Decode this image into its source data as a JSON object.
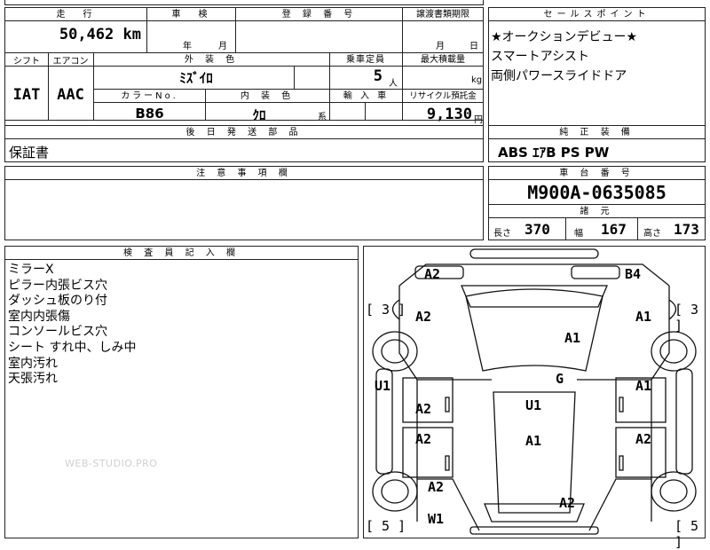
{
  "header_labels": {
    "mileage": "走　行",
    "inspection": "車　検",
    "registration": "登 録 番 号",
    "transfer_deadline": "譲渡書類期限",
    "sales_point": "セールスポイント",
    "shift": "シフト",
    "aircon": "エアコン",
    "exterior_color": "外 装 色",
    "capacity": "乗車定員",
    "max_load": "最大積載量",
    "color_no": "カラーNo.",
    "interior_color": "内 装 色",
    "import": "輸 入 車",
    "recycle": "リサイクル預託金",
    "later_parts": "後 日 発 送 部 品",
    "standard_equipment": "純 正 装 備",
    "notes": "注 意 事 項 欄",
    "chassis_number": "車 台 番 号",
    "specs": "諸 元",
    "inspector_notes": "検 査 員 記 入 欄"
  },
  "values": {
    "mileage": "50,462",
    "mileage_unit": "km",
    "inspection_year_unit": "年",
    "inspection_month_unit": "月",
    "transfer_month_unit": "月",
    "transfer_day_unit": "日",
    "shift": "IAT",
    "aircon": "AAC",
    "exterior_color": "ﾐｽﾞｲﾛ",
    "capacity": "5",
    "capacity_unit": "人",
    "max_load_unit": "kg",
    "color_no": "B86",
    "interior_color": "ｸﾛ",
    "interior_color_suffix": "系",
    "recycle": "9,130",
    "recycle_unit": "円",
    "later_parts": "保証書",
    "standard_equipment": "ABS ｴｱB PS PW",
    "chassis_number": "M900A-0635085"
  },
  "sales_points": [
    "★オークションデビュー★",
    "スマートアシスト",
    "両側パワースライドドア"
  ],
  "specs": {
    "length_label": "長さ",
    "length": "370",
    "width_label": "幅",
    "width": "167",
    "height_label": "高さ",
    "height": "173"
  },
  "inspector_notes": [
    "ミラーX",
    "ピラー内張ビス穴",
    "ダッシュ板のり付",
    "室内内張傷",
    "コンソールビス穴",
    "シート すれ中、しみ中",
    "室内汚れ",
    "天張汚れ"
  ],
  "diagram_labels": {
    "top_left": "A2",
    "top_right": "B4",
    "bracket_left_upper": "[ 3 ]",
    "bracket_right_upper": "[ 3 ]",
    "left_front_seat": "A2",
    "right_front_seat": "A1",
    "dash": "A1",
    "left_side": "U1",
    "console": "G",
    "left_door_upper": "A2",
    "center": "U1",
    "right_door_upper": "A1",
    "left_door_lower": "A2",
    "center_lower": "A1",
    "right_door_lower": "A2",
    "left_rear": "A2",
    "rear_center": "A2",
    "left_rear_bottom": "W1",
    "bracket_left_lower": "[ 5 ]",
    "bracket_right_lower": "[ 5 ]"
  },
  "watermark": "WEB-STUDIO.PRO"
}
